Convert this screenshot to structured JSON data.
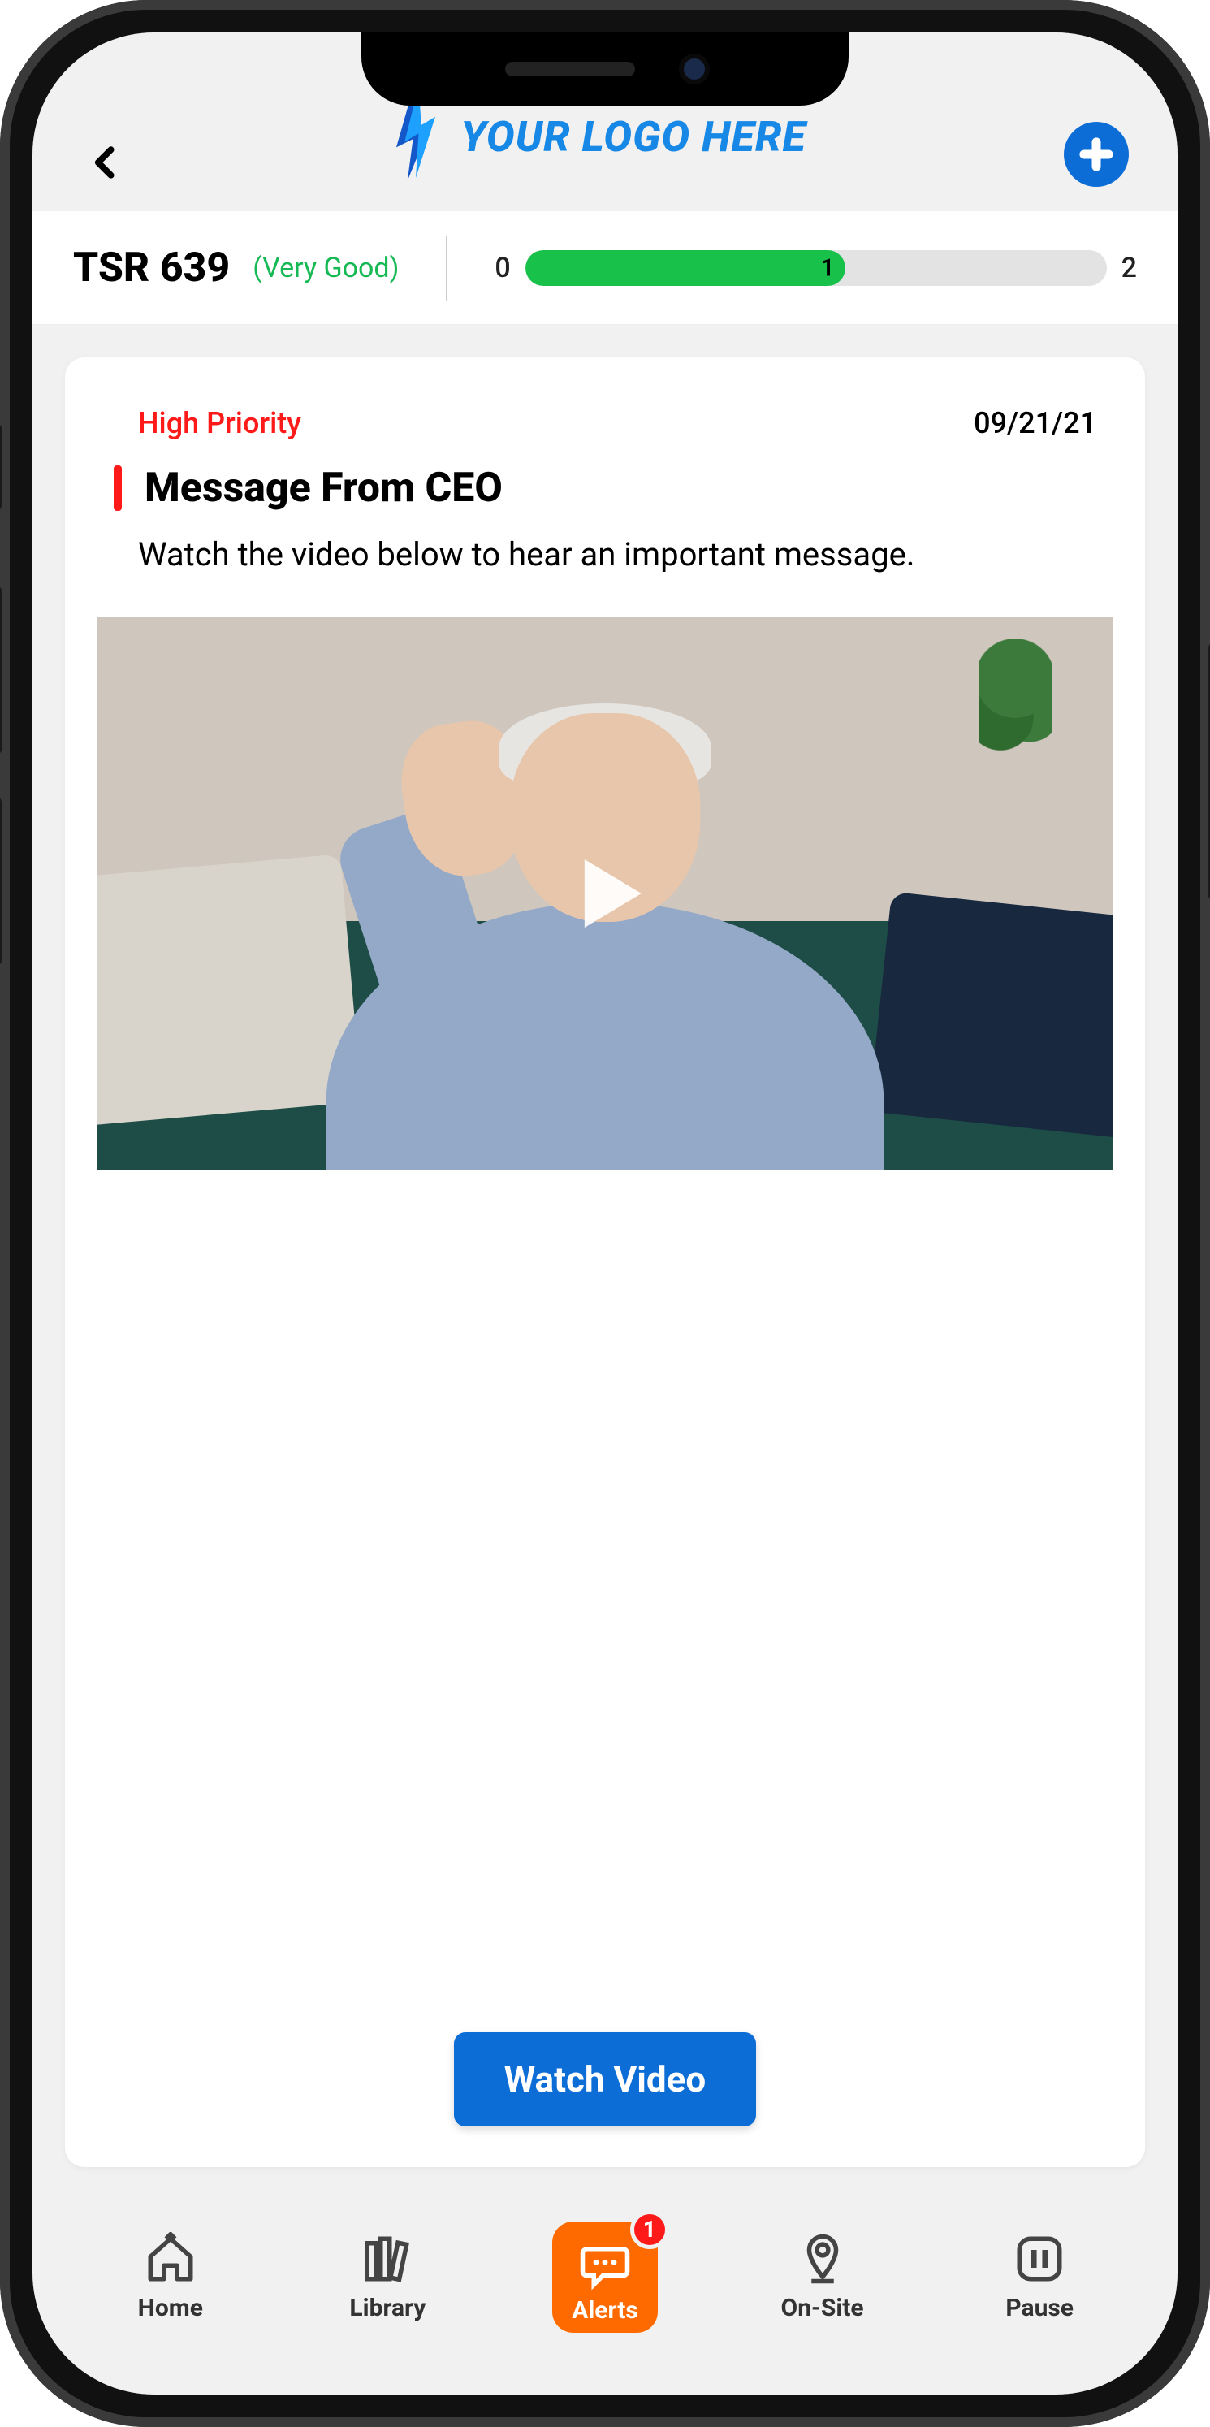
{
  "header": {
    "logo_text": "YOUR LOGO HERE"
  },
  "tsr": {
    "label": "TSR 639",
    "rating": "(Very Good)",
    "gauge_min": "0",
    "gauge_mid": "1",
    "gauge_max": "2"
  },
  "alert": {
    "priority": "High Priority",
    "date": "09/21/21",
    "title": "Message From CEO",
    "body": "Watch the video below to hear an important message.",
    "cta": "Watch Video"
  },
  "tabs": {
    "home": "Home",
    "library": "Library",
    "alerts": "Alerts",
    "onsite": "On-Site",
    "pause": "Pause",
    "alerts_badge": "1"
  }
}
